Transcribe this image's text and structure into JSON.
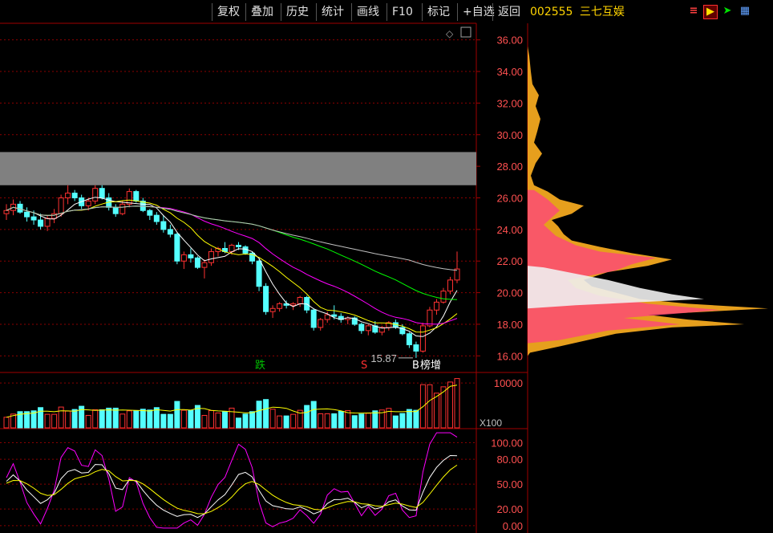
{
  "toolbar": {
    "buttons": [
      "复权",
      "叠加",
      "历史",
      "统计",
      "画线",
      "F10",
      "标记",
      "+自选",
      "返回"
    ],
    "stock_code": "002555",
    "stock_name": "三七互娱"
  },
  "price_panel": {
    "yticks": [
      "36.00",
      "34.00",
      "32.00",
      "30.00",
      "28.00",
      "26.00",
      "24.00",
      "22.00",
      "20.00",
      "18.00",
      "16.00"
    ],
    "low_label": "15.87",
    "marks": [
      {
        "text": "跌",
        "color": "#00c000"
      },
      {
        "text": "S",
        "color": "#ff3030"
      },
      {
        "text": "B",
        "color": "#ffffff"
      },
      {
        "text": "榜增",
        "color": "#ffffff"
      }
    ]
  },
  "volume_panel": {
    "ytick": "10000",
    "unit": "X100"
  },
  "indicator_panel": {
    "yticks": [
      "100.00",
      "80.00",
      "50.00",
      "20.00",
      "0.00"
    ]
  },
  "colors": {
    "up": "#ff3232",
    "down": "#54ffff",
    "grid": "#8b0000",
    "axis": "#a00000",
    "label": "#ff5050",
    "ma5": "#ffffff",
    "ma10": "#ffff00",
    "ma20": "#ff00ff",
    "ma60": "#00ff00",
    "ma120": "#c0c0c0",
    "band": "#808080"
  },
  "chart_data": {
    "type": "candlestick",
    "price_range": [
      15.0,
      37.0
    ],
    "resistance_band": [
      26.8,
      28.9
    ],
    "candles": [
      [
        25.0,
        25.6,
        24.6,
        25.2
      ],
      [
        25.2,
        25.9,
        24.9,
        25.6
      ],
      [
        25.6,
        25.8,
        25.0,
        25.1
      ],
      [
        25.1,
        25.4,
        24.5,
        24.8
      ],
      [
        24.8,
        25.2,
        24.3,
        24.6
      ],
      [
        24.6,
        25.0,
        24.0,
        24.2
      ],
      [
        24.2,
        24.9,
        23.9,
        24.7
      ],
      [
        24.7,
        25.3,
        24.4,
        25.0
      ],
      [
        25.0,
        26.2,
        24.8,
        26.0
      ],
      [
        26.0,
        26.8,
        25.6,
        26.3
      ],
      [
        26.3,
        26.5,
        25.8,
        26.0
      ],
      [
        26.0,
        26.2,
        25.3,
        25.5
      ],
      [
        25.5,
        26.0,
        25.2,
        25.8
      ],
      [
        25.8,
        26.8,
        25.6,
        26.6
      ],
      [
        26.6,
        26.8,
        25.9,
        26.0
      ],
      [
        26.0,
        26.3,
        25.2,
        25.4
      ],
      [
        25.4,
        25.6,
        24.8,
        25.0
      ],
      [
        25.0,
        25.8,
        24.9,
        25.6
      ],
      [
        25.6,
        26.6,
        25.4,
        26.4
      ],
      [
        26.4,
        26.5,
        25.7,
        25.8
      ],
      [
        25.8,
        26.0,
        25.1,
        25.2
      ],
      [
        25.2,
        25.3,
        24.6,
        24.9
      ],
      [
        24.9,
        25.1,
        24.3,
        24.5
      ],
      [
        24.5,
        24.9,
        23.8,
        24.0
      ],
      [
        24.0,
        24.3,
        23.5,
        23.7
      ],
      [
        23.7,
        23.8,
        21.8,
        22.0
      ],
      [
        22.0,
        22.6,
        21.5,
        22.4
      ],
      [
        22.4,
        22.8,
        21.9,
        22.2
      ],
      [
        22.2,
        22.3,
        21.5,
        21.6
      ],
      [
        21.6,
        22.1,
        20.9,
        21.9
      ],
      [
        21.9,
        22.8,
        21.7,
        22.6
      ],
      [
        22.6,
        22.9,
        22.3,
        22.8
      ],
      [
        22.8,
        23.2,
        22.5,
        22.6
      ],
      [
        22.6,
        23.1,
        22.4,
        23.0
      ],
      [
        23.0,
        23.2,
        22.7,
        22.9
      ],
      [
        22.9,
        23.0,
        22.4,
        22.5
      ],
      [
        22.5,
        22.6,
        21.8,
        22.0
      ],
      [
        22.0,
        22.1,
        20.1,
        20.4
      ],
      [
        20.4,
        20.6,
        18.6,
        18.8
      ],
      [
        18.8,
        19.2,
        18.4,
        19.0
      ],
      [
        19.0,
        19.4,
        18.8,
        19.3
      ],
      [
        19.3,
        19.5,
        19.0,
        19.2
      ],
      [
        19.2,
        19.4,
        18.9,
        19.3
      ],
      [
        19.3,
        19.8,
        19.1,
        19.7
      ],
      [
        19.7,
        19.8,
        18.7,
        18.9
      ],
      [
        18.9,
        19.0,
        17.6,
        17.8
      ],
      [
        17.8,
        18.4,
        17.6,
        18.3
      ],
      [
        18.3,
        18.8,
        18.1,
        18.6
      ],
      [
        18.6,
        19.2,
        18.3,
        18.5
      ],
      [
        18.5,
        18.7,
        18.1,
        18.3
      ],
      [
        18.3,
        18.5,
        18.0,
        18.4
      ],
      [
        18.4,
        18.5,
        17.9,
        18.0
      ],
      [
        18.0,
        18.1,
        17.4,
        17.6
      ],
      [
        17.6,
        18.0,
        17.3,
        17.9
      ],
      [
        17.9,
        18.2,
        17.4,
        17.5
      ],
      [
        17.5,
        17.9,
        17.3,
        17.8
      ],
      [
        17.8,
        18.2,
        17.6,
        18.1
      ],
      [
        18.1,
        18.3,
        17.7,
        17.8
      ],
      [
        17.8,
        18.0,
        17.3,
        17.4
      ],
      [
        17.4,
        17.5,
        16.5,
        16.7
      ],
      [
        16.7,
        16.9,
        15.87,
        16.3
      ],
      [
        16.3,
        18.1,
        16.2,
        17.9
      ],
      [
        17.9,
        19.1,
        17.8,
        18.9
      ],
      [
        18.9,
        19.6,
        18.6,
        19.4
      ],
      [
        19.4,
        20.3,
        19.3,
        20.1
      ],
      [
        20.1,
        21.0,
        19.9,
        20.8
      ],
      [
        20.8,
        22.6,
        20.6,
        21.5
      ]
    ]
  }
}
